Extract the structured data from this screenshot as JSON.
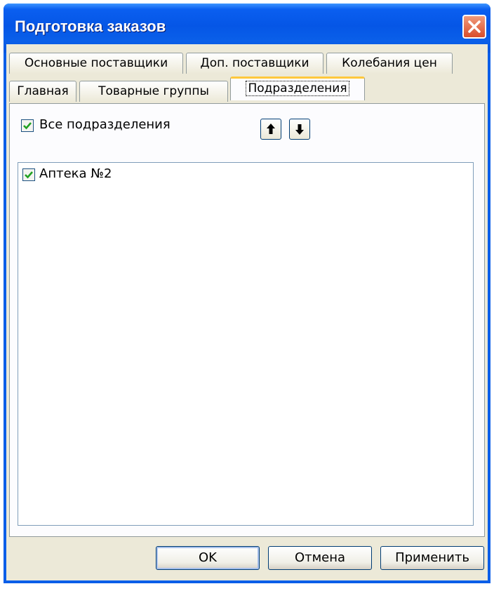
{
  "window": {
    "title": "Подготовка заказов"
  },
  "tabs": {
    "row1": [
      "Основные поставщики",
      "Доп. поставщики",
      "Колебания цен"
    ],
    "row2": [
      "Главная",
      "Товарные группы",
      "Подразделения"
    ],
    "active": "Подразделения"
  },
  "panel": {
    "all_checkbox": {
      "label": "Все подразделения",
      "checked": true
    },
    "move_up_icon": "arrow-up-icon",
    "move_down_icon": "arrow-down-icon",
    "items": [
      {
        "label": "Аптека №2",
        "checked": true
      }
    ]
  },
  "buttons": {
    "ok": "OK",
    "cancel": "Отмена",
    "apply": "Применить"
  },
  "colors": {
    "titlebar": "#0a5ee8",
    "face": "#ece9d8",
    "check": "#21a121",
    "active_tab_accent": "#ffc83c"
  }
}
